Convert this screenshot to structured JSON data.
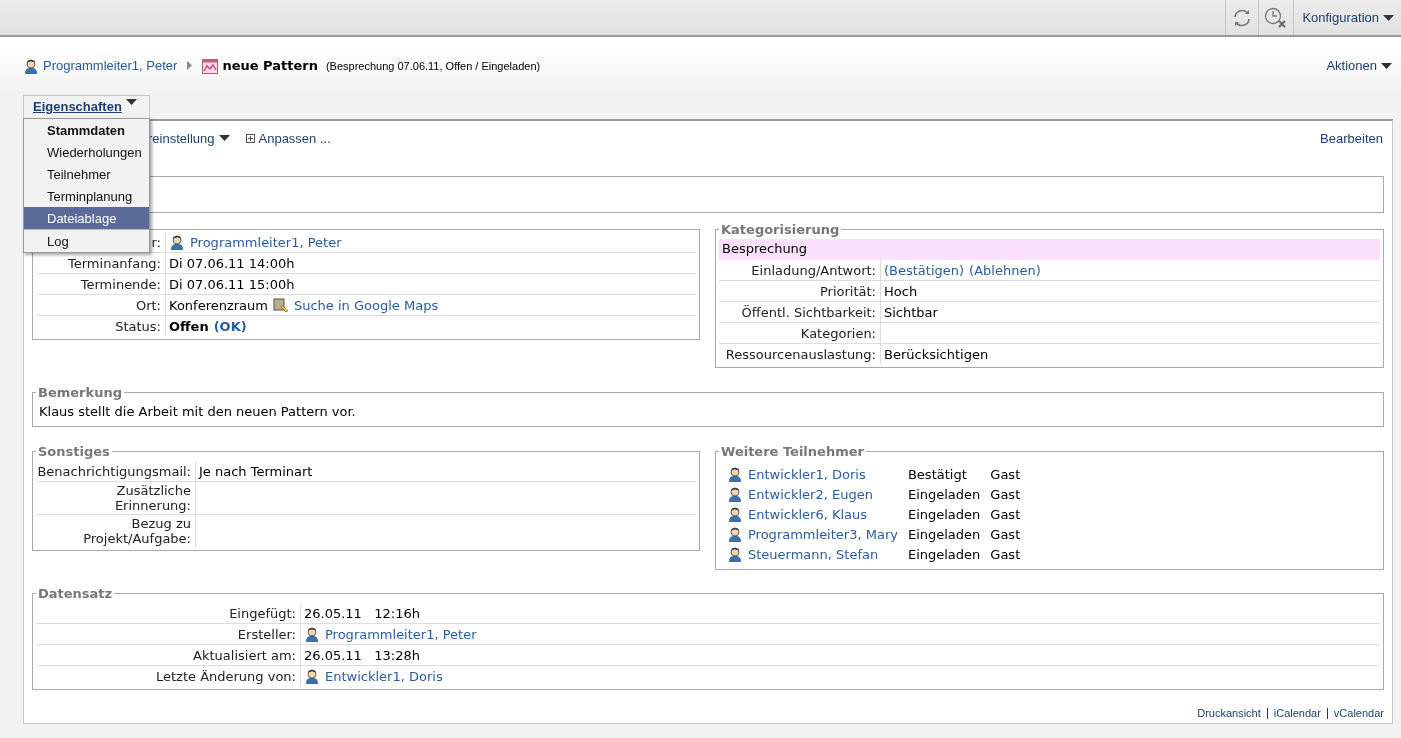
{
  "top_bar": {
    "config_menu": "Konfiguration"
  },
  "breadcrumb": {
    "parent": "Programmleiter1, Peter",
    "title": "neue Pattern",
    "subtitle": "(Besprechung 07.06.11, Offen / Eingeladen)"
  },
  "actions_menu": "Aktionen",
  "tab": {
    "label": "Eigenschaften"
  },
  "menu": [
    {
      "label": "Stammdaten",
      "current": true,
      "selected": false
    },
    {
      "label": "Wiederholungen",
      "current": false,
      "selected": false
    },
    {
      "label": "Teilnehmer",
      "current": false,
      "selected": false
    },
    {
      "label": "Terminplanung",
      "current": false,
      "selected": false
    },
    {
      "label": "Dateiablage",
      "current": false,
      "selected": true
    },
    {
      "label": "Log",
      "current": false,
      "selected": false
    }
  ],
  "toolbar": {
    "view_menu": "reinstellung",
    "customize": "Anpassen ...",
    "edit": "Bearbeiten"
  },
  "termin": {
    "rows": [
      {
        "label": "r:",
        "kind": "person",
        "value": "Programmleiter1, Peter"
      },
      {
        "label": "Terminanfang:",
        "kind": "text",
        "value": "Di 07.06.11 14:00h"
      },
      {
        "label": "Terminende:",
        "kind": "text",
        "value": "Di 07.06.11 15:00h"
      },
      {
        "label": "Ort:",
        "kind": "location",
        "value": "Konferenzraum",
        "link": "Suche in Google Maps"
      },
      {
        "label": "Status:",
        "kind": "status",
        "value": "Offen",
        "link": "(OK)"
      }
    ]
  },
  "kategorisierung": {
    "legend": "Kategorisierung",
    "category": {
      "label": "Besprechung",
      "color": "#fbe0fb"
    },
    "rows": [
      {
        "label": "Einladung/Antwort:",
        "kind": "links",
        "links": [
          "(Bestätigen)",
          "(Ablehnen)"
        ]
      },
      {
        "label": "Priorität:",
        "kind": "text",
        "value": "Hoch"
      },
      {
        "label": "Öffentl. Sichtbarkeit:",
        "kind": "text",
        "value": "Sichtbar"
      },
      {
        "label": "Kategorien:",
        "kind": "text"
      },
      {
        "label": "Ressourcenauslastung:",
        "kind": "text",
        "value": "Berücksichtigen"
      }
    ]
  },
  "bemerkung": {
    "legend": "Bemerkung",
    "text": "Klaus stellt die Arbeit mit den neuen Pattern vor."
  },
  "sonstiges": {
    "legend": "Sonstiges",
    "rows": [
      {
        "label": "Benachrichtigungsmail:",
        "value": "Je nach Terminart"
      },
      {
        "label": "Zusätzliche Erinnerung:"
      },
      {
        "label": "Bezug zu Projekt/Aufgabe:"
      }
    ]
  },
  "teilnehmer": {
    "legend": "Weitere Teilnehmer",
    "rows": [
      {
        "name": "Entwickler1, Doris",
        "status": "Bestätigt",
        "role": "Gast"
      },
      {
        "name": "Entwickler2, Eugen",
        "status": "Eingeladen",
        "role": "Gast"
      },
      {
        "name": "Entwickler6, Klaus",
        "status": "Eingeladen",
        "role": "Gast"
      },
      {
        "name": "Programmleiter3, Mary",
        "status": "Eingeladen",
        "role": "Gast"
      },
      {
        "name": "Steuermann, Stefan",
        "status": "Eingeladen",
        "role": "Gast"
      }
    ]
  },
  "datensatz": {
    "legend": "Datensatz",
    "rows": [
      {
        "label": "Eingefügt:",
        "kind": "text",
        "value": "26.05.11   12:16h"
      },
      {
        "label": "Ersteller:",
        "kind": "person",
        "value": "Programmleiter1, Peter"
      },
      {
        "label": "Aktualisiert am:",
        "kind": "text",
        "value": "26.05.11   13:28h"
      },
      {
        "label": "Letzte Änderung von:",
        "kind": "person",
        "value": "Entwickler1, Doris"
      }
    ]
  },
  "footer_links": [
    "Druckansicht",
    "iCalendar",
    "vCalendar"
  ]
}
